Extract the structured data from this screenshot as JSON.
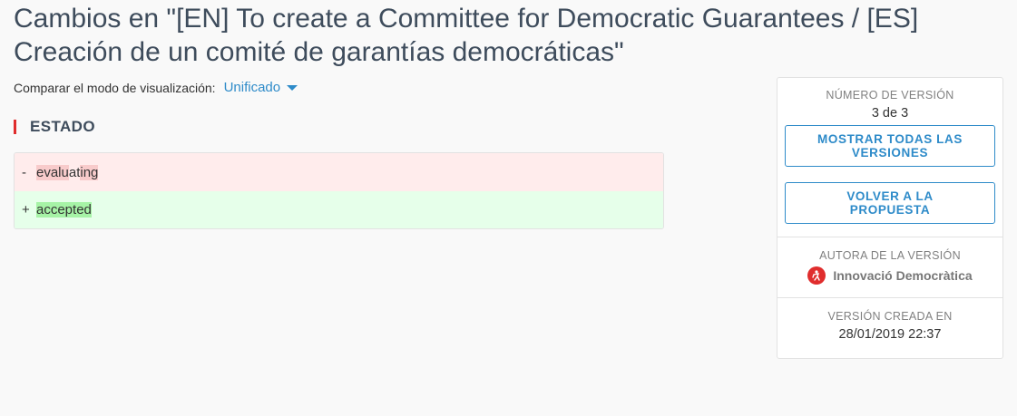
{
  "page": {
    "title": "Cambios en \"[EN] To create a Committee for Democratic Guarantees / [ES] Creación de un comité de garantías democráticas\""
  },
  "compare": {
    "label": "Comparar el modo de visualización:",
    "mode": "Unificado",
    "icon": "caret-down-icon"
  },
  "section": {
    "title": "ESTADO"
  },
  "diff": {
    "removed": {
      "sign": "-",
      "text_pre": "",
      "text_chunk1": "evalu",
      "text_mid": "at",
      "text_chunk2": "ing",
      "full": "evaluating"
    },
    "added": {
      "sign": "+",
      "text": "accepted"
    }
  },
  "sidebar": {
    "version_label": "NÚMERO DE VERSIÓN",
    "version_value": "3 de 3",
    "show_all_button": "MOSTRAR TODAS LAS VERSIONES",
    "back_button": "VOLVER A LA PROPUESTA",
    "author_label": "AUTORA DE LA VERSIÓN",
    "author_name": "Innovació Democràtica",
    "author_icon": "organization-avatar-icon",
    "created_label": "VERSIÓN CREADA EN",
    "created_value": "28/01/2019 22:37"
  },
  "colors": {
    "accent": "#2e8bc9",
    "section_marker": "#e02d2d",
    "removed_bg": "#ffecec",
    "added_bg": "#e6ffea"
  }
}
